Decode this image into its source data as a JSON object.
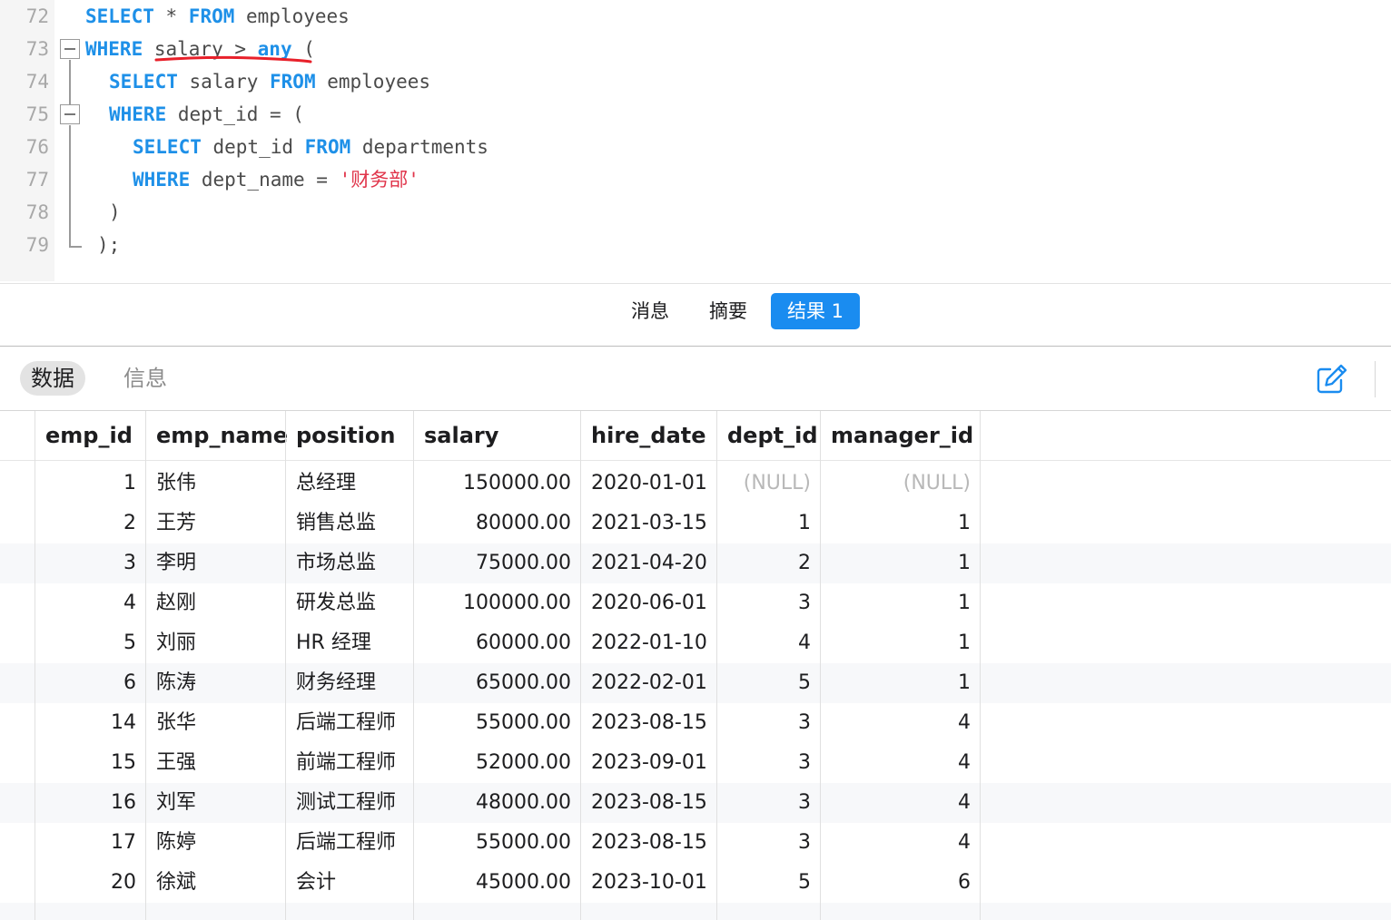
{
  "editor": {
    "line_numbers": [
      "72",
      "73",
      "74",
      "75",
      "76",
      "77",
      "78",
      "79"
    ],
    "tokens": {
      "select": "SELECT",
      "star": " * ",
      "from": "FROM",
      "employees": " employees",
      "where": "WHERE",
      "salary_gt": " salary > ",
      "any": "any",
      "open_paren": " (",
      "salary_from": " salary ",
      "dept_id_eq": " dept_id = (",
      "dept_id_from": " dept_id ",
      "departments": " departments",
      "dept_name_eq": " dept_name = ",
      "dept_name_value": "'财务部'",
      "close_paren": ")",
      "close_paren_semi": ");"
    }
  },
  "result_tabs": [
    "消息",
    "摘要",
    "结果 1"
  ],
  "active_result_tab": "结果 1",
  "sub_tabs": [
    "数据",
    "信息"
  ],
  "active_sub_tab": "数据",
  "icons": {
    "edit": "edit-icon"
  },
  "colors": {
    "keyword": "#1e90e8",
    "string": "#e0344a",
    "accent": "#1a8cf0",
    "null_text": "#b8b8b8"
  },
  "table": {
    "columns": [
      "emp_id",
      "emp_name",
      "position",
      "salary",
      "hire_date",
      "dept_id",
      "manager_id"
    ],
    "rows": [
      [
        "1",
        "张伟",
        "总经理",
        "150000.00",
        "2020-01-01",
        "(NULL)",
        "(NULL)"
      ],
      [
        "2",
        "王芳",
        "销售总监",
        "80000.00",
        "2021-03-15",
        "1",
        "1"
      ],
      [
        "3",
        "李明",
        "市场总监",
        "75000.00",
        "2021-04-20",
        "2",
        "1"
      ],
      [
        "4",
        "赵刚",
        "研发总监",
        "100000.00",
        "2020-06-01",
        "3",
        "1"
      ],
      [
        "5",
        "刘丽",
        "HR 经理",
        "60000.00",
        "2022-01-10",
        "4",
        "1"
      ],
      [
        "6",
        "陈涛",
        "财务经理",
        "65000.00",
        "2022-02-01",
        "5",
        "1"
      ],
      [
        "14",
        "张华",
        "后端工程师",
        "55000.00",
        "2023-08-15",
        "3",
        "4"
      ],
      [
        "15",
        "王强",
        "前端工程师",
        "52000.00",
        "2023-09-01",
        "3",
        "4"
      ],
      [
        "16",
        "刘军",
        "测试工程师",
        "48000.00",
        "2023-08-15",
        "3",
        "4"
      ],
      [
        "17",
        "陈婷",
        "后端工程师",
        "55000.00",
        "2023-08-15",
        "3",
        "4"
      ],
      [
        "20",
        "徐斌",
        "会计",
        "45000.00",
        "2023-10-01",
        "5",
        "6"
      ],
      [
        "",
        "",
        "",
        "",
        "",
        "",
        ""
      ]
    ]
  }
}
